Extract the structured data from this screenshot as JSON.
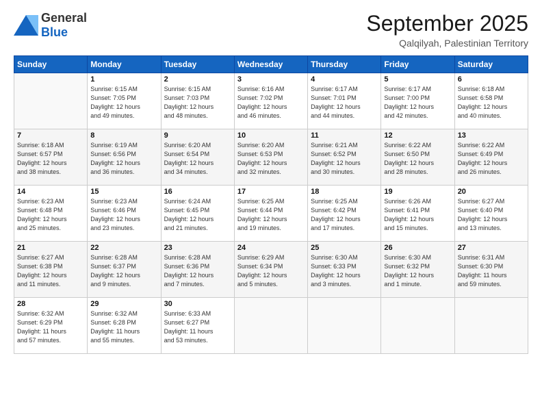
{
  "header": {
    "logo_general": "General",
    "logo_blue": "Blue",
    "month": "September 2025",
    "location": "Qalqilyah, Palestinian Territory"
  },
  "weekdays": [
    "Sunday",
    "Monday",
    "Tuesday",
    "Wednesday",
    "Thursday",
    "Friday",
    "Saturday"
  ],
  "weeks": [
    [
      {
        "day": "",
        "info": ""
      },
      {
        "day": "1",
        "info": "Sunrise: 6:15 AM\nSunset: 7:05 PM\nDaylight: 12 hours\nand 49 minutes."
      },
      {
        "day": "2",
        "info": "Sunrise: 6:15 AM\nSunset: 7:03 PM\nDaylight: 12 hours\nand 48 minutes."
      },
      {
        "day": "3",
        "info": "Sunrise: 6:16 AM\nSunset: 7:02 PM\nDaylight: 12 hours\nand 46 minutes."
      },
      {
        "day": "4",
        "info": "Sunrise: 6:17 AM\nSunset: 7:01 PM\nDaylight: 12 hours\nand 44 minutes."
      },
      {
        "day": "5",
        "info": "Sunrise: 6:17 AM\nSunset: 7:00 PM\nDaylight: 12 hours\nand 42 minutes."
      },
      {
        "day": "6",
        "info": "Sunrise: 6:18 AM\nSunset: 6:58 PM\nDaylight: 12 hours\nand 40 minutes."
      }
    ],
    [
      {
        "day": "7",
        "info": "Sunrise: 6:18 AM\nSunset: 6:57 PM\nDaylight: 12 hours\nand 38 minutes."
      },
      {
        "day": "8",
        "info": "Sunrise: 6:19 AM\nSunset: 6:56 PM\nDaylight: 12 hours\nand 36 minutes."
      },
      {
        "day": "9",
        "info": "Sunrise: 6:20 AM\nSunset: 6:54 PM\nDaylight: 12 hours\nand 34 minutes."
      },
      {
        "day": "10",
        "info": "Sunrise: 6:20 AM\nSunset: 6:53 PM\nDaylight: 12 hours\nand 32 minutes."
      },
      {
        "day": "11",
        "info": "Sunrise: 6:21 AM\nSunset: 6:52 PM\nDaylight: 12 hours\nand 30 minutes."
      },
      {
        "day": "12",
        "info": "Sunrise: 6:22 AM\nSunset: 6:50 PM\nDaylight: 12 hours\nand 28 minutes."
      },
      {
        "day": "13",
        "info": "Sunrise: 6:22 AM\nSunset: 6:49 PM\nDaylight: 12 hours\nand 26 minutes."
      }
    ],
    [
      {
        "day": "14",
        "info": "Sunrise: 6:23 AM\nSunset: 6:48 PM\nDaylight: 12 hours\nand 25 minutes."
      },
      {
        "day": "15",
        "info": "Sunrise: 6:23 AM\nSunset: 6:46 PM\nDaylight: 12 hours\nand 23 minutes."
      },
      {
        "day": "16",
        "info": "Sunrise: 6:24 AM\nSunset: 6:45 PM\nDaylight: 12 hours\nand 21 minutes."
      },
      {
        "day": "17",
        "info": "Sunrise: 6:25 AM\nSunset: 6:44 PM\nDaylight: 12 hours\nand 19 minutes."
      },
      {
        "day": "18",
        "info": "Sunrise: 6:25 AM\nSunset: 6:42 PM\nDaylight: 12 hours\nand 17 minutes."
      },
      {
        "day": "19",
        "info": "Sunrise: 6:26 AM\nSunset: 6:41 PM\nDaylight: 12 hours\nand 15 minutes."
      },
      {
        "day": "20",
        "info": "Sunrise: 6:27 AM\nSunset: 6:40 PM\nDaylight: 12 hours\nand 13 minutes."
      }
    ],
    [
      {
        "day": "21",
        "info": "Sunrise: 6:27 AM\nSunset: 6:38 PM\nDaylight: 12 hours\nand 11 minutes."
      },
      {
        "day": "22",
        "info": "Sunrise: 6:28 AM\nSunset: 6:37 PM\nDaylight: 12 hours\nand 9 minutes."
      },
      {
        "day": "23",
        "info": "Sunrise: 6:28 AM\nSunset: 6:36 PM\nDaylight: 12 hours\nand 7 minutes."
      },
      {
        "day": "24",
        "info": "Sunrise: 6:29 AM\nSunset: 6:34 PM\nDaylight: 12 hours\nand 5 minutes."
      },
      {
        "day": "25",
        "info": "Sunrise: 6:30 AM\nSunset: 6:33 PM\nDaylight: 12 hours\nand 3 minutes."
      },
      {
        "day": "26",
        "info": "Sunrise: 6:30 AM\nSunset: 6:32 PM\nDaylight: 12 hours\nand 1 minute."
      },
      {
        "day": "27",
        "info": "Sunrise: 6:31 AM\nSunset: 6:30 PM\nDaylight: 11 hours\nand 59 minutes."
      }
    ],
    [
      {
        "day": "28",
        "info": "Sunrise: 6:32 AM\nSunset: 6:29 PM\nDaylight: 11 hours\nand 57 minutes."
      },
      {
        "day": "29",
        "info": "Sunrise: 6:32 AM\nSunset: 6:28 PM\nDaylight: 11 hours\nand 55 minutes."
      },
      {
        "day": "30",
        "info": "Sunrise: 6:33 AM\nSunset: 6:27 PM\nDaylight: 11 hours\nand 53 minutes."
      },
      {
        "day": "",
        "info": ""
      },
      {
        "day": "",
        "info": ""
      },
      {
        "day": "",
        "info": ""
      },
      {
        "day": "",
        "info": ""
      }
    ]
  ]
}
